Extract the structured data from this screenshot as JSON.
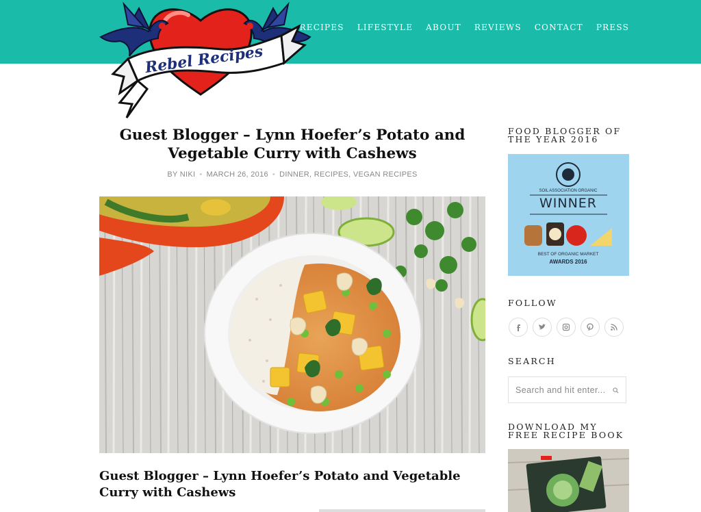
{
  "site": {
    "logo_text": "Rebel Recipes"
  },
  "nav": {
    "items": [
      {
        "label": "RECIPES"
      },
      {
        "label": "LIFESTYLE"
      },
      {
        "label": "ABOUT"
      },
      {
        "label": "REVIEWS"
      },
      {
        "label": "CONTACT"
      },
      {
        "label": "PRESS"
      }
    ]
  },
  "post": {
    "title": "Guest Blogger – Lynn Hoefer’s Potato and Vegetable Curry with Cashews",
    "author": "BY NIKI",
    "date": "MARCH 26, 2016",
    "categories": [
      "DINNER",
      "RECIPES",
      "VEGAN RECIPES"
    ],
    "excerpt_title": "Guest Blogger – Lynn Hoefer’s Potato and Vegetable Curry with Cashews"
  },
  "sidebar": {
    "award_title": "FOOD BLOGGER OF THE YEAR 2016",
    "award": {
      "seal_text": "SOIL ASSOCIATION ORGANIC",
      "winner": "WINNER",
      "line1": "BEST OF ORGANIC MARKET",
      "line2": "AWARDS 2016"
    },
    "follow_title": "FOLLOW",
    "socials": [
      {
        "icon": "facebook-icon",
        "glyph": "f"
      },
      {
        "icon": "twitter-icon",
        "glyph": "t"
      },
      {
        "icon": "instagram-icon",
        "glyph": "ig"
      },
      {
        "icon": "pinterest-icon",
        "glyph": "p"
      },
      {
        "icon": "rss-icon",
        "glyph": "rss"
      }
    ],
    "search_title": "SEARCH",
    "search_placeholder": "Search and hit enter...",
    "download_title": "DOWNLOAD MY FREE RECIPE BOOK"
  },
  "colors": {
    "header": "#1abba9",
    "accent_red": "#e3231b"
  }
}
